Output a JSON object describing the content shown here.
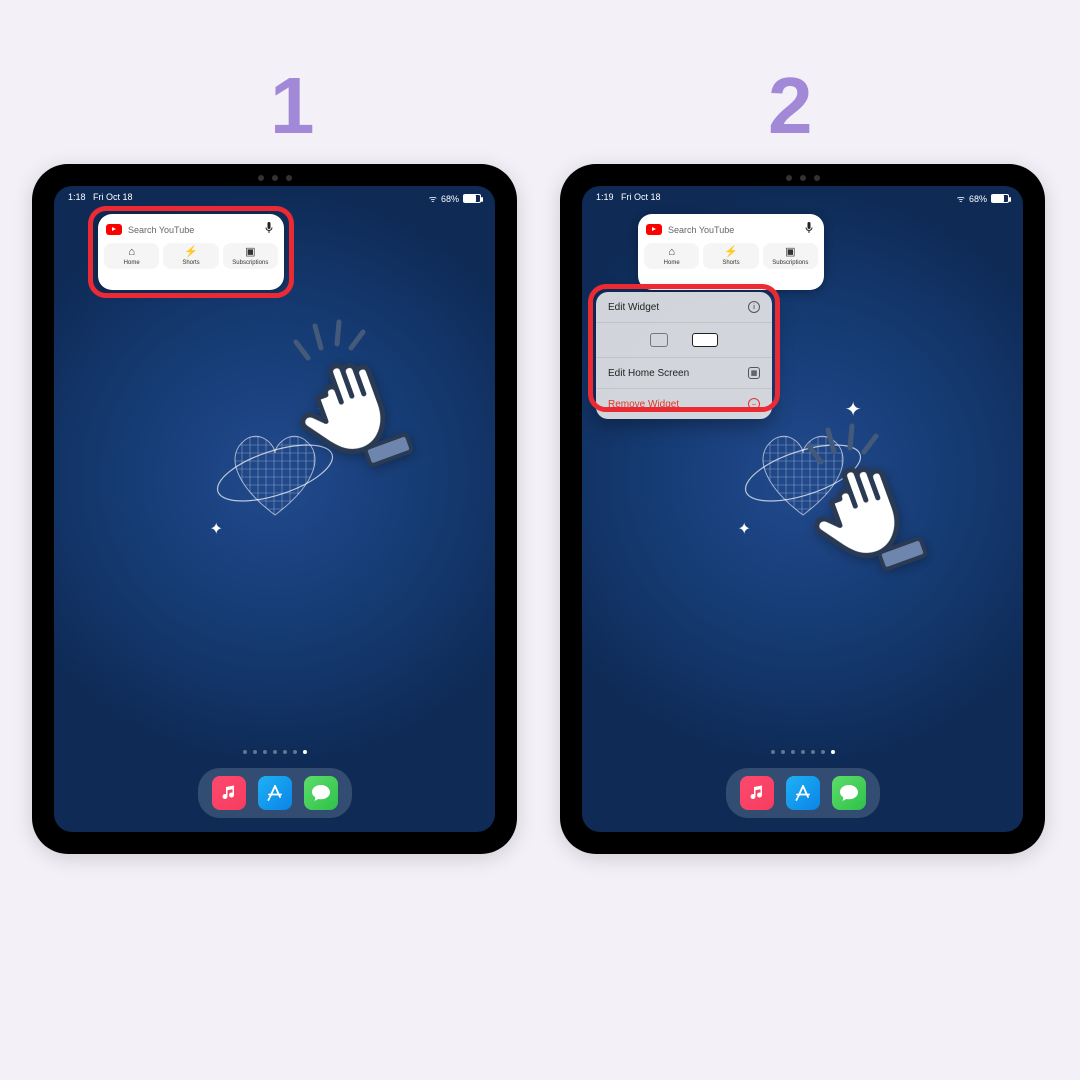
{
  "steps": {
    "one": "1",
    "two": "2"
  },
  "panel1": {
    "status": {
      "time": "1:18",
      "date": "Fri Oct 18",
      "battery": "68%"
    }
  },
  "panel2": {
    "status": {
      "time": "1:19",
      "date": "Fri Oct 18",
      "battery": "68%"
    }
  },
  "widget": {
    "search_placeholder": "Search YouTube",
    "tabs": {
      "home": "Home",
      "shorts": "Shorts",
      "subs": "Subscriptions"
    }
  },
  "context_menu": {
    "edit_widget": "Edit Widget",
    "edit_home": "Edit Home Screen",
    "remove": "Remove Widget"
  },
  "dock": {
    "music": "♪",
    "store": "A",
    "messages": "✉"
  },
  "icons": {
    "mic": "🎤",
    "home": "⌂",
    "shorts": "⚡",
    "subs": "▣",
    "wifi": "ᯤ"
  }
}
